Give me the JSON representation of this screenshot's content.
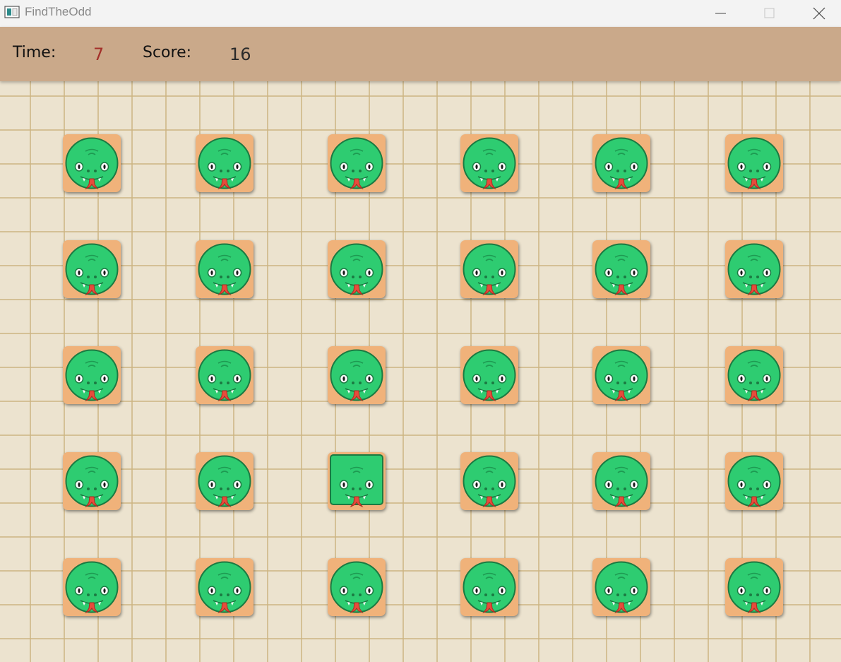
{
  "window": {
    "title": "FindTheOdd",
    "controls": [
      "minimize-icon",
      "maximize-icon",
      "close-icon"
    ]
  },
  "hud": {
    "time_label": "Time:",
    "time_value": "7",
    "score_label": "Score:",
    "score_value": "16"
  },
  "board": {
    "rows": 5,
    "cols": 6,
    "tile_icon": "snake-head-icon",
    "odd_tile_icon": "square-snake-head-icon",
    "odd_tile": {
      "row": 4,
      "col": 3
    }
  },
  "colors": {
    "hud_background": "#caa98a",
    "board_background": "#ece3cf",
    "tile": "#f0b27a",
    "snake": "#2ecc71",
    "time_value": "#a3302a"
  }
}
